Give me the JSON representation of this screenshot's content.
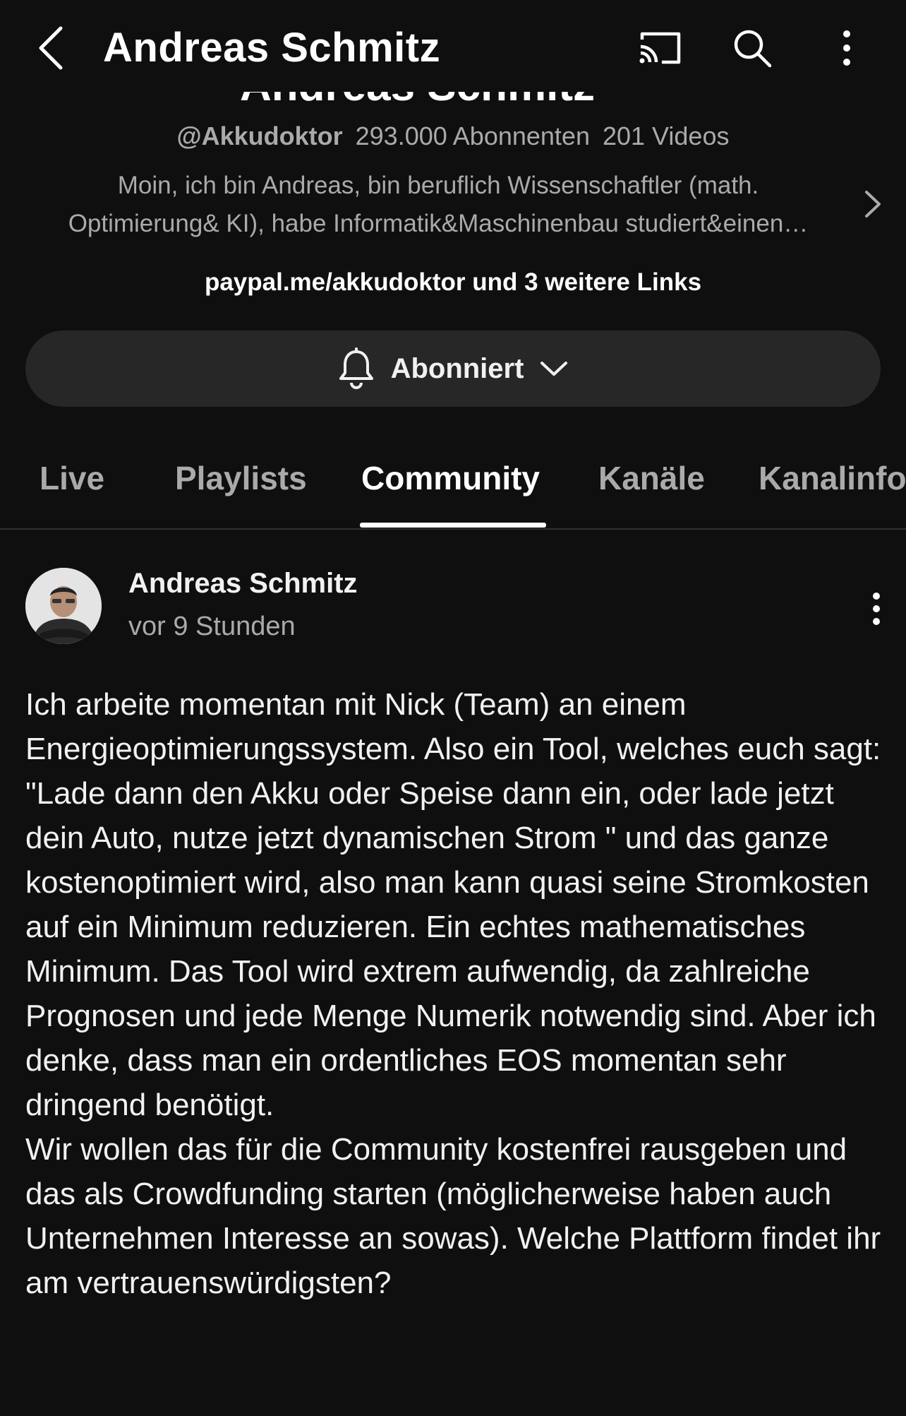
{
  "header": {
    "title": "Andreas Schmitz",
    "back_icon": "back-chevron-icon",
    "cast_icon": "cast-icon",
    "search_icon": "search-icon",
    "more_icon": "more-vertical-icon"
  },
  "channel": {
    "name": "Andreas Schmitz",
    "handle": "@Akkudoktor",
    "subscribers": "293.000 Abonnenten",
    "videos": "201 Videos",
    "description_line1": "Moin, ich bin Andreas, bin beruflich Wissenschaftler (math.",
    "description_line2": "Optimierung& KI), habe Informatik&Maschinenbau studiert&einen…",
    "links": "paypal.me/akkudoktor und 3 weitere Links",
    "subscribe_label": "Abonniert"
  },
  "tabs": [
    {
      "label": "Live",
      "active": false
    },
    {
      "label": "Playlists",
      "active": false
    },
    {
      "label": "Community",
      "active": true
    },
    {
      "label": "Kanäle",
      "active": false
    },
    {
      "label": "Kanalinfo",
      "active": false
    }
  ],
  "post": {
    "author": "Andreas Schmitz",
    "time": "vor 9 Stunden",
    "paragraph1": "Ich arbeite momentan mit Nick (Team) an einem Energieoptimierungssystem. Also ein Tool, welches euch sagt: \"Lade dann den Akku oder Speise dann ein, oder lade jetzt dein Auto, nutze jetzt dynamischen Strom \" und das ganze kostenoptimiert wird, also man kann quasi seine Stromkosten auf ein Minimum reduzieren. Ein echtes mathematisches Minimum. Das Tool wird extrem aufwendig, da zahlreiche Prognosen und jede Menge Numerik notwendig sind. Aber ich denke, dass man ein ordentliches EOS momentan sehr dringend benötigt.",
    "paragraph2": "Wir wollen das für die Community kostenfrei rausgeben und das als Crowdfunding starten (möglicherweise haben auch Unternehmen Interesse an sowas). Welche Plattform findet ihr am vertrauenswürdigsten?"
  },
  "colors": {
    "background": "#0f0f0f",
    "button_bg": "#272727",
    "text_primary": "#f1f1f1",
    "text_secondary": "#aaaaaa"
  }
}
